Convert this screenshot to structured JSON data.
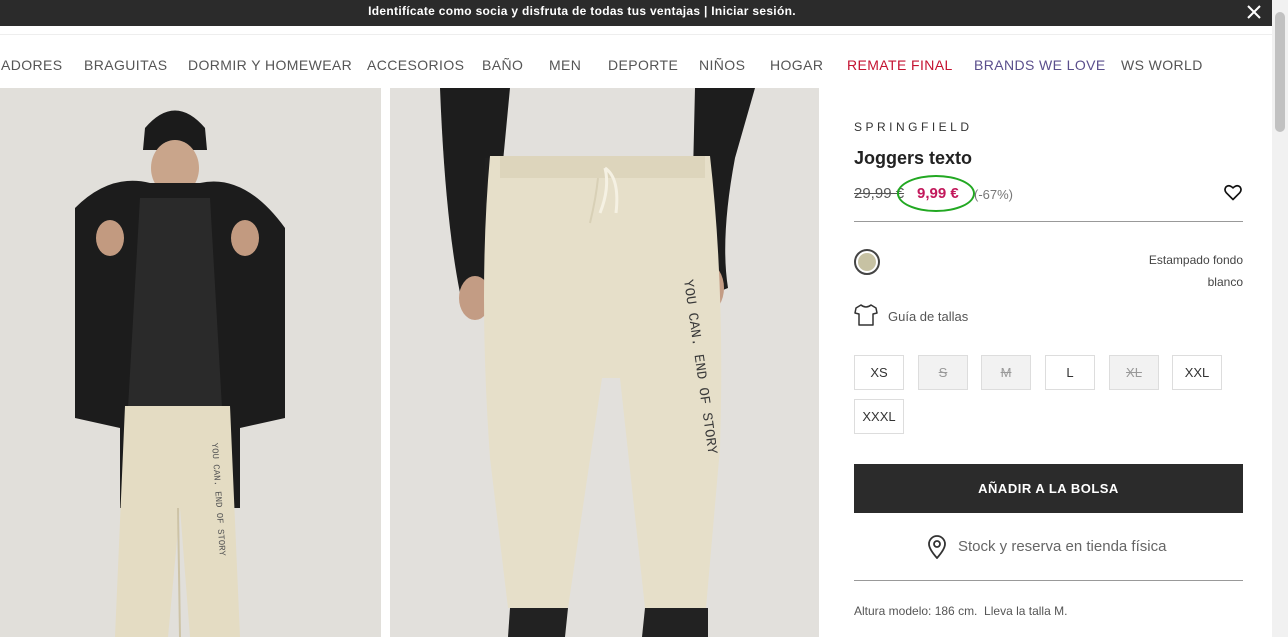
{
  "announcement": {
    "text": "Identifícate como socia y disfruta de todas tus ventajas | Iniciar sesión.",
    "close_icon": "close-icon"
  },
  "nav": {
    "items": [
      "ADORES",
      "BRAGUITAS",
      "DORMIR Y HOMEWEAR",
      "ACCESORIOS",
      "BAÑO",
      "MEN",
      "DEPORTE",
      "NIÑOS",
      "HOGAR",
      "REMATE FINAL",
      "BRANDS WE LOVE",
      "WS WORLD"
    ],
    "highlight_colors": {
      "remate": "#c41230",
      "brands": "#5a4e8c"
    }
  },
  "product": {
    "brand": "SPRINGFIELD",
    "title": "Joggers texto",
    "old_price": "29,99 €",
    "new_price": "9,99 €",
    "discount": "(-67%)",
    "color_name_line1": "Estampado fondo",
    "color_name_line2": "blanco",
    "swatch_color": "#c7c2a3",
    "size_guide": "Guía de tallas",
    "sizes": [
      {
        "label": "XS",
        "available": true
      },
      {
        "label": "S",
        "available": false
      },
      {
        "label": "M",
        "available": false
      },
      {
        "label": "L",
        "available": true
      },
      {
        "label": "XL",
        "available": false
      },
      {
        "label": "XXL",
        "available": true
      },
      {
        "label": "XXXL",
        "available": true
      }
    ],
    "add_to_bag": "AÑADIR A LA BOLSA",
    "stock_reserve": "Stock y reserva en tienda física",
    "model_info": "Altura modelo: 186 cm.  Lleva la talla M."
  },
  "images": {
    "photo_1": "model-front-jacket",
    "photo_2": "model-joggers-closeup",
    "text_on_joggers": "YOU CAN. END OF STORY"
  },
  "colors": {
    "accent_price": "#c2185b",
    "annotation_circle": "#22a822",
    "dark_button": "#2b2b2b"
  }
}
